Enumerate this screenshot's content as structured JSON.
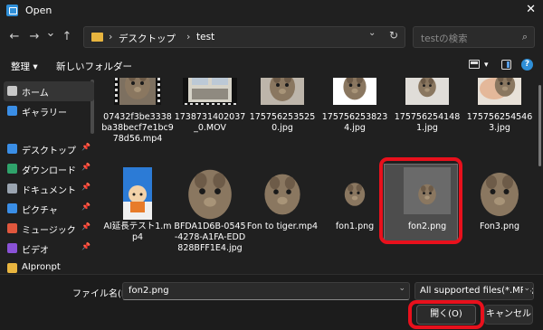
{
  "window": {
    "title": "Open",
    "close_glyph": "✕"
  },
  "nav": {
    "back": "←",
    "forward": "→",
    "dropdown": "⌄",
    "up": "↑"
  },
  "address": {
    "sep": "›",
    "crumbs": [
      "デスクトップ",
      "test"
    ],
    "dropdown": "⌄",
    "refresh": "↻"
  },
  "search": {
    "placeholder": "testの検索",
    "icon": "⌕"
  },
  "toolbar": {
    "organize": "整理 ▾",
    "new_folder": "新しいフォルダー",
    "view_dd": "▾"
  },
  "sidebar": {
    "items": [
      {
        "label": "ホーム",
        "icon": "home-icon",
        "color": "#c8c8c8",
        "active": true,
        "pinned": false
      },
      {
        "label": "ギャラリー",
        "icon": "gallery-icon",
        "color": "#3a8ee6",
        "active": false,
        "pinned": false
      },
      {
        "label": "デスクトップ",
        "icon": "desktop-icon",
        "color": "#3a8ee6",
        "active": false,
        "pinned": true
      },
      {
        "label": "ダウンロード",
        "icon": "download-icon",
        "color": "#2fa36b",
        "active": false,
        "pinned": true
      },
      {
        "label": "ドキュメント",
        "icon": "documents-icon",
        "color": "#9aa4b0",
        "active": false,
        "pinned": true
      },
      {
        "label": "ピクチャ",
        "icon": "pictures-icon",
        "color": "#3a8ee6",
        "active": false,
        "pinned": true
      },
      {
        "label": "ミュージック",
        "icon": "music-icon",
        "color": "#e0573d",
        "active": false,
        "pinned": true
      },
      {
        "label": "ビデオ",
        "icon": "videos-icon",
        "color": "#8a52d6",
        "active": false,
        "pinned": true
      },
      {
        "label": "AIpronpt",
        "icon": "folder-icon",
        "color": "#e8b53f",
        "active": false,
        "pinned": false
      }
    ],
    "pin_glyph": "📌"
  },
  "files": {
    "row1": [
      {
        "name": "07432f3be3338ba38becf7e1bc978d56.mp4",
        "kind": "video-degu"
      },
      {
        "name": "1738731402037_0.MOV",
        "kind": "video-room"
      },
      {
        "name": "1757562535250.jpg",
        "kind": "photo-degu"
      },
      {
        "name": "1757562538234.jpg",
        "kind": "photo-degu-checker"
      },
      {
        "name": "1757562541481.jpg",
        "kind": "photo-degu-small"
      },
      {
        "name": "1757562545463.jpg",
        "kind": "photo-hand"
      }
    ],
    "row2": [
      {
        "name": "AI延長テスト1.mp4",
        "kind": "anime"
      },
      {
        "name": "BFDA1D6B-0545-4278-A1FA-EDD828BFF1E4.jpg",
        "kind": "degu-big"
      },
      {
        "name": "Fon to tiger.mp4",
        "kind": "degu-mid"
      },
      {
        "name": "fon1.png",
        "kind": "degu-tiny"
      },
      {
        "name": "fon2.png",
        "kind": "degu-tiny-selected"
      },
      {
        "name": "Fon3.png",
        "kind": "degu-big2"
      }
    ]
  },
  "footer": {
    "filename_label": "ファイル名(N):",
    "filename_value": "fon2.png",
    "filetype_value": "All supported files(*.MP4;*",
    "open_label": "開く(O)",
    "cancel_label": "キャンセル",
    "dropdown": "⌄"
  },
  "colors": {
    "highlight_red": "#e8101c",
    "background": "#202020"
  }
}
